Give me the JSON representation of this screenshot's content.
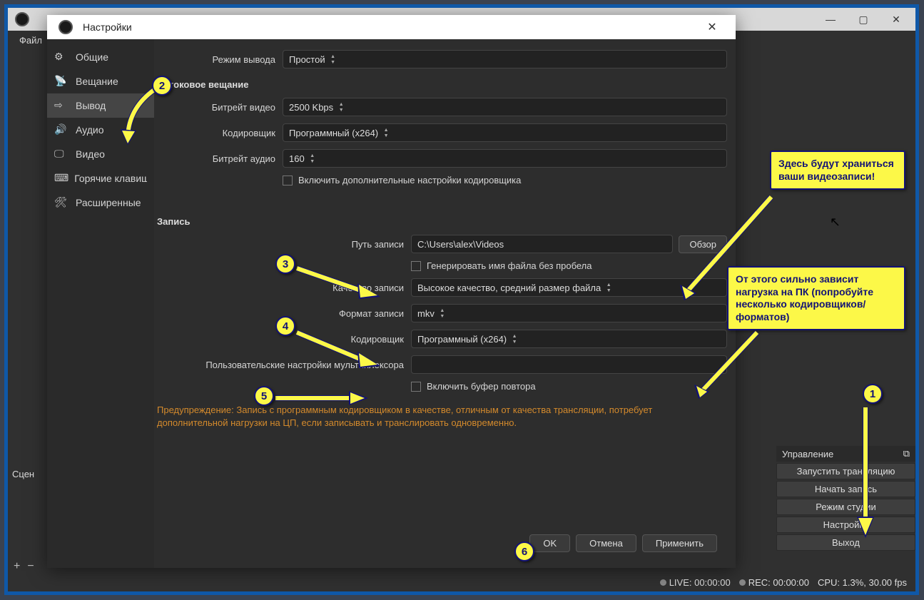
{
  "main": {
    "menu_file": "Файл",
    "scenes": "Сцен",
    "controls_header": "Управление",
    "start_stream": "Запустить трансляцию",
    "start_record": "Начать запись",
    "studio_mode": "Режим студии",
    "settings": "Настройки",
    "exit": "Выход",
    "live": "LIVE: 00:00:00",
    "rec": "REC: 00:00:00",
    "cpu": "CPU: 1.3%, 30.00 fps"
  },
  "dialog": {
    "title": "Настройки",
    "sidebar": {
      "general": "Общие",
      "stream": "Вещание",
      "output": "Вывод",
      "audio": "Аудио",
      "video": "Видео",
      "hotkeys": "Горячие клавиши",
      "advanced": "Расширенные"
    },
    "output_mode_label": "Режим вывода",
    "output_mode_value": "Простой",
    "section_streaming": "Потоковое вещание",
    "video_bitrate_label": "Битрейт видео",
    "video_bitrate_value": "2500 Kbps",
    "encoder_label": "Кодировщик",
    "encoder_value": "Программный (x264)",
    "audio_bitrate_label": "Битрейт аудио",
    "audio_bitrate_value": "160",
    "enable_adv_enc": "Включить дополнительные настройки кодировщика",
    "section_recording": "Запись",
    "record_path_label": "Путь записи",
    "record_path_value": "C:\\Users\\alex\\Videos",
    "browse": "Обзор",
    "gen_name": "Генерировать имя файла без пробела",
    "rec_quality_label": "Качество записи",
    "rec_quality_value": "Высокое качество, средний размер файла",
    "rec_format_label": "Формат записи",
    "rec_format_value": "mkv",
    "rec_encoder_label": "Кодировщик",
    "rec_encoder_value": "Программный (x264)",
    "mux_label": "Пользовательские настройки мультиплексора",
    "enable_replay": "Включить буфер повтора",
    "warning": "Предупреждение: Запись с программным кодировщиком в качестве, отличным от качества трансляции, потребует дополнительной нагрузки на ЦП, если записывать и транслировать одновременно.",
    "ok": "OK",
    "cancel": "Отмена",
    "apply": "Применить"
  },
  "callouts": {
    "c1": "Здесь будут храниться ваши видеозаписи!",
    "c2": "От этого сильно зависит нагрузка на ПК (попробуйте несколько кодировщиков/форматов)"
  },
  "markers": {
    "m1": "1",
    "m2": "2",
    "m3": "3",
    "m4": "4",
    "m5": "5",
    "m6": "6"
  }
}
